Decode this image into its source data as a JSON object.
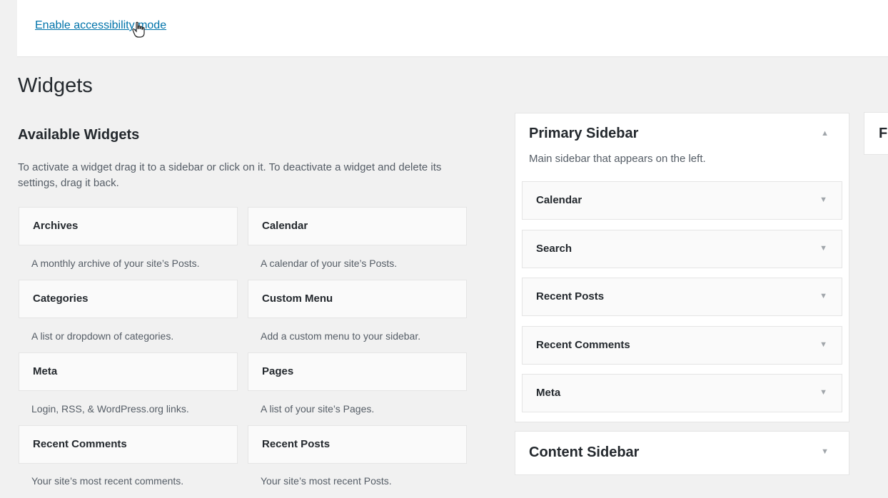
{
  "help": {
    "accessibility_link": "Enable accessibility mode"
  },
  "page": {
    "title": "Widgets"
  },
  "available": {
    "title": "Available Widgets",
    "description": "To activate a widget drag it to a sidebar or click on it. To deactivate a widget and delete its settings, drag it back.",
    "widgets": [
      {
        "title": "Archives",
        "desc": "A monthly archive of your site’s Posts."
      },
      {
        "title": "Calendar",
        "desc": "A calendar of your site’s Posts."
      },
      {
        "title": "Categories",
        "desc": "A list or dropdown of categories."
      },
      {
        "title": "Custom Menu",
        "desc": "Add a custom menu to your sidebar."
      },
      {
        "title": "Meta",
        "desc": "Login, RSS, & WordPress.org links."
      },
      {
        "title": "Pages",
        "desc": "A list of your site’s Pages."
      },
      {
        "title": "Recent Comments",
        "desc": "Your site’s most recent comments."
      },
      {
        "title": "Recent Posts",
        "desc": "Your site’s most recent Posts."
      }
    ]
  },
  "primary_sidebar": {
    "title": "Primary Sidebar",
    "description": "Main sidebar that appears on the left.",
    "widgets": [
      "Calendar",
      "Search",
      "Recent Posts",
      "Recent Comments",
      "Meta"
    ]
  },
  "content_sidebar": {
    "title": "Content Sidebar"
  },
  "footer_sidebar": {
    "title": "Footer Widget Area"
  },
  "icons": {
    "collapse": "arrow-up-icon",
    "expand": "arrow-down-icon",
    "cursor": "hand-pointer-icon"
  },
  "colors": {
    "link": "#0073aa",
    "background": "#f1f1f1",
    "panel": "#ffffff",
    "widget": "#fafafa"
  }
}
